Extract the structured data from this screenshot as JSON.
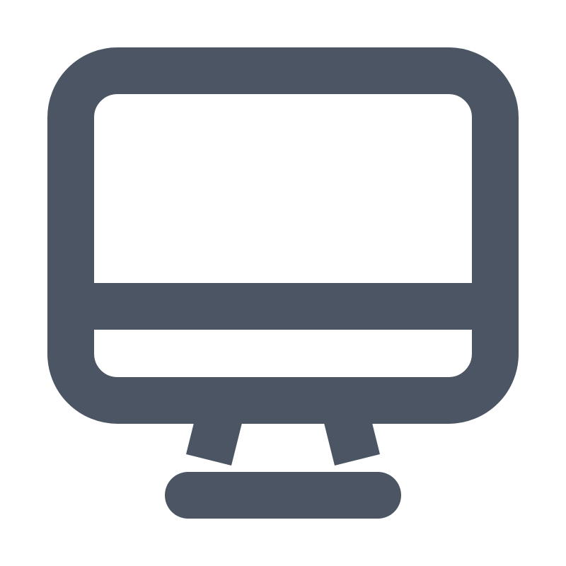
{
  "icon": {
    "name": "desktop-computer-icon",
    "stroke_color": "#4b5563",
    "background": "#ffffff"
  }
}
